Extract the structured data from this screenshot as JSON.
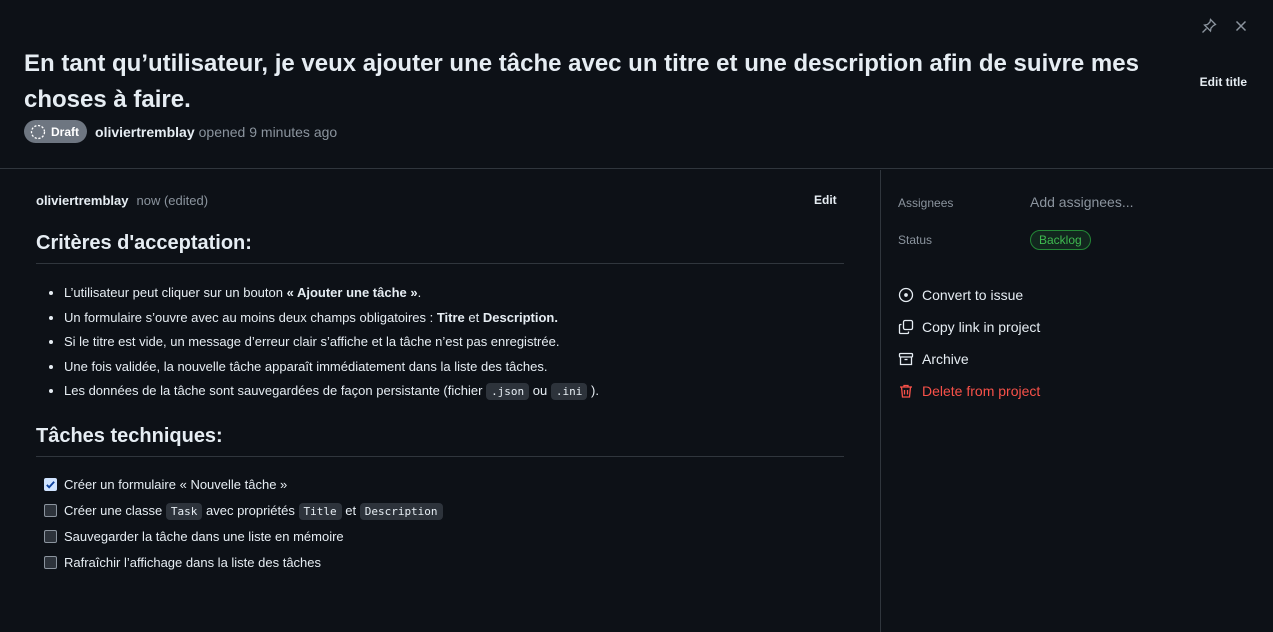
{
  "header": {
    "title": "En tant qu’utilisateur, je veux ajouter une tâche avec un titre et une description afin de suivre mes choses à faire.",
    "edit_title_label": "Edit title",
    "draft_label": "Draft",
    "author": "oliviertremblay",
    "opened_text": "opened 9 minutes ago"
  },
  "comment": {
    "author": "oliviertremblay",
    "time": "now (edited)",
    "edit_label": "Edit"
  },
  "acceptance": {
    "heading": "Critères d'acceptation:",
    "items": [
      {
        "pre": "L’utilisateur peut cliquer sur un bouton ",
        "bold": "« Ajouter une tâche »",
        "post": "."
      },
      {
        "pre": "Un formulaire s’ouvre avec au moins deux champs obligatoires : ",
        "b1": "Titre",
        "mid": " et ",
        "b2": "Description."
      },
      {
        "text": "Si le titre est vide, un message d’erreur clair s’affiche et la tâche n’est pas enregistrée."
      },
      {
        "text": "Une fois validée, la nouvelle tâche apparaît immédiatement dans la liste des tâches."
      },
      {
        "pre": "Les données de la tâche sont sauvegardées de façon persistante (fichier ",
        "code1": ".json",
        "mid": " ou ",
        "code2": ".ini",
        "post": " )."
      }
    ]
  },
  "technical": {
    "heading": "Tâches techniques:",
    "tasks": [
      {
        "checked": true,
        "text": "Créer un formulaire « Nouvelle tâche »"
      },
      {
        "checked": false,
        "pre": "Créer une classe ",
        "code1": "Task",
        "mid": " avec propriétés ",
        "code2": "Title",
        "mid2": " et ",
        "code3": "Description"
      },
      {
        "checked": false,
        "text": "Sauvegarder la tâche dans une liste en mémoire"
      },
      {
        "checked": false,
        "text": "Rafraîchir l’affichage dans la liste des tâches"
      }
    ]
  },
  "sidebar": {
    "assignees_label": "Assignees",
    "assignees_value": "Add assignees...",
    "status_label": "Status",
    "status_value": "Backlog",
    "actions": [
      {
        "label": "Convert to issue",
        "icon": "issue-opened-icon"
      },
      {
        "label": "Copy link in project",
        "icon": "copy-icon"
      },
      {
        "label": "Archive",
        "icon": "archive-icon"
      },
      {
        "label": "Delete from project",
        "icon": "trash-icon"
      }
    ]
  },
  "colors": {
    "background": "#0d1117",
    "border": "#30363d",
    "status_green": "#3fb950",
    "danger": "#f85149",
    "draft_gray": "#6e7681"
  }
}
